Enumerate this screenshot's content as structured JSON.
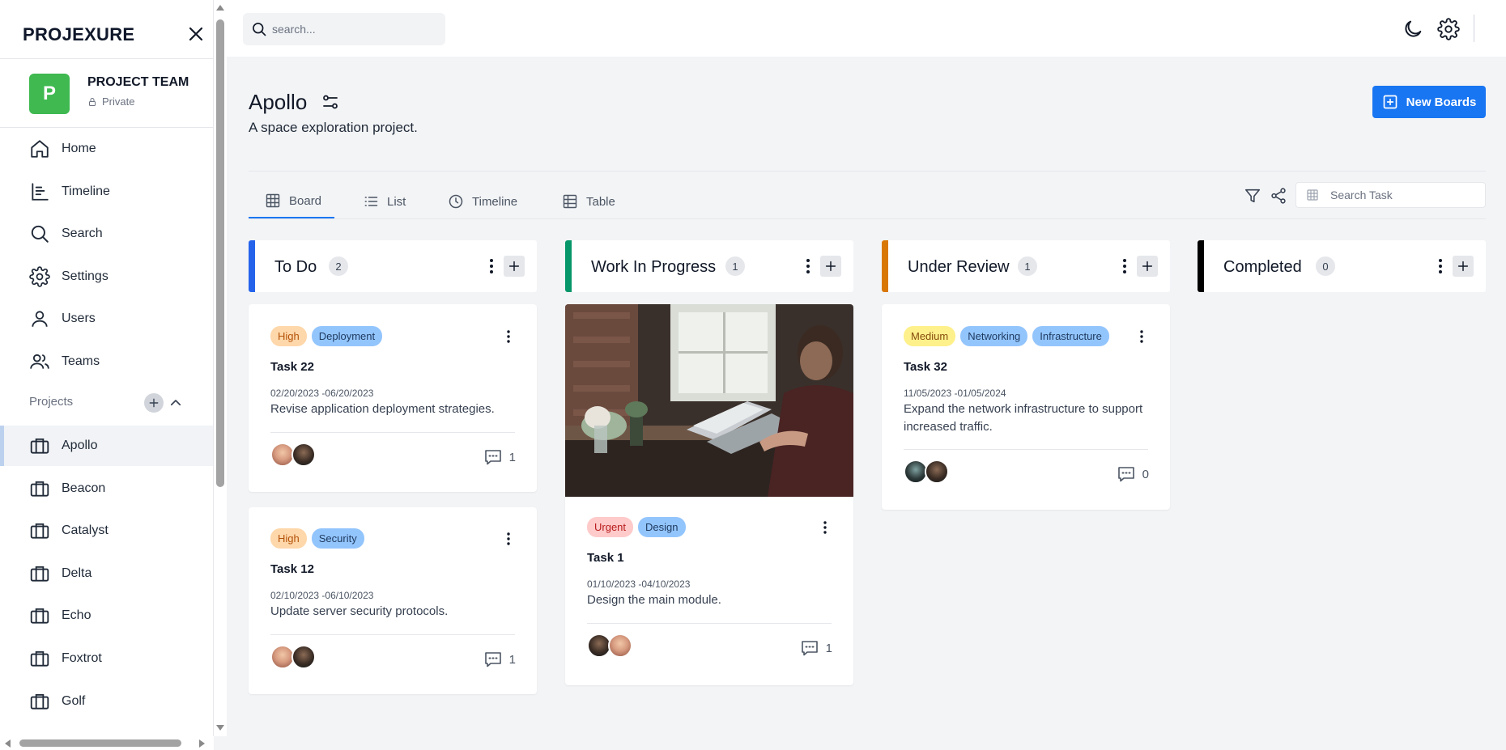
{
  "sidebar": {
    "brand": "PROJEXURE",
    "team": {
      "initial": "P",
      "name": "PROJECT TEAM",
      "visibility": "Private",
      "color": "#3fb950"
    },
    "nav": [
      {
        "label": "Home",
        "icon": "home-icon"
      },
      {
        "label": "Timeline",
        "icon": "timeline-icon"
      },
      {
        "label": "Search",
        "icon": "search-icon"
      },
      {
        "label": "Settings",
        "icon": "gear-icon"
      },
      {
        "label": "Users",
        "icon": "user-icon"
      },
      {
        "label": "Teams",
        "icon": "users-icon"
      }
    ],
    "projects_label": "Projects",
    "projects": [
      "Apollo",
      "Beacon",
      "Catalyst",
      "Delta",
      "Echo",
      "Foxtrot",
      "Golf"
    ],
    "active_project": "Apollo"
  },
  "topbar": {
    "search_placeholder": "search...",
    "icons": [
      "moon-icon",
      "gear-icon"
    ]
  },
  "page": {
    "title": "Apollo",
    "description": "A space exploration project.",
    "new_boards_label": "New Boards",
    "tabs": [
      {
        "label": "Board",
        "icon": "grid-icon",
        "active": true
      },
      {
        "label": "List",
        "icon": "list-icon"
      },
      {
        "label": "Timeline",
        "icon": "clock-icon"
      },
      {
        "label": "Table",
        "icon": "table-icon"
      }
    ],
    "task_search_placeholder": "Search Task"
  },
  "columns": [
    {
      "title": "To Do",
      "count": "2",
      "color": "#2563eb",
      "cards": [
        {
          "tags": [
            "High",
            "Deployment"
          ],
          "title": "Task 22",
          "dates": "02/20/2023 -06/20/2023",
          "description": "Revise application deployment strategies.",
          "comments": "1"
        },
        {
          "tags": [
            "High",
            "Security"
          ],
          "title": "Task 12",
          "dates": "02/10/2023 -06/10/2023",
          "description": "Update server security protocols.",
          "comments": "1"
        }
      ]
    },
    {
      "title": "Work In Progress",
      "count": "1",
      "color": "#059669",
      "cards": [
        {
          "tags": [
            "Urgent",
            "Design"
          ],
          "title": "Task 1",
          "dates": "01/10/2023 -04/10/2023",
          "description": "Design the main module.",
          "comments": "1",
          "image": "person-working-on-laptop-photo"
        }
      ]
    },
    {
      "title": "Under Review",
      "count": "1",
      "color": "#d97706",
      "cards": [
        {
          "tags": [
            "Medium",
            "Networking",
            "Infrastructure"
          ],
          "title": "Task 32",
          "dates": "11/05/2023 -01/05/2024",
          "description": "Expand the network infrastructure to support increased traffic.",
          "comments": "0"
        }
      ]
    },
    {
      "title": "Completed",
      "count": "0",
      "color": "#000000",
      "cards": []
    }
  ],
  "colors": {
    "primary": "#1976f2",
    "active_nav_bg": "#f1f3f6"
  }
}
